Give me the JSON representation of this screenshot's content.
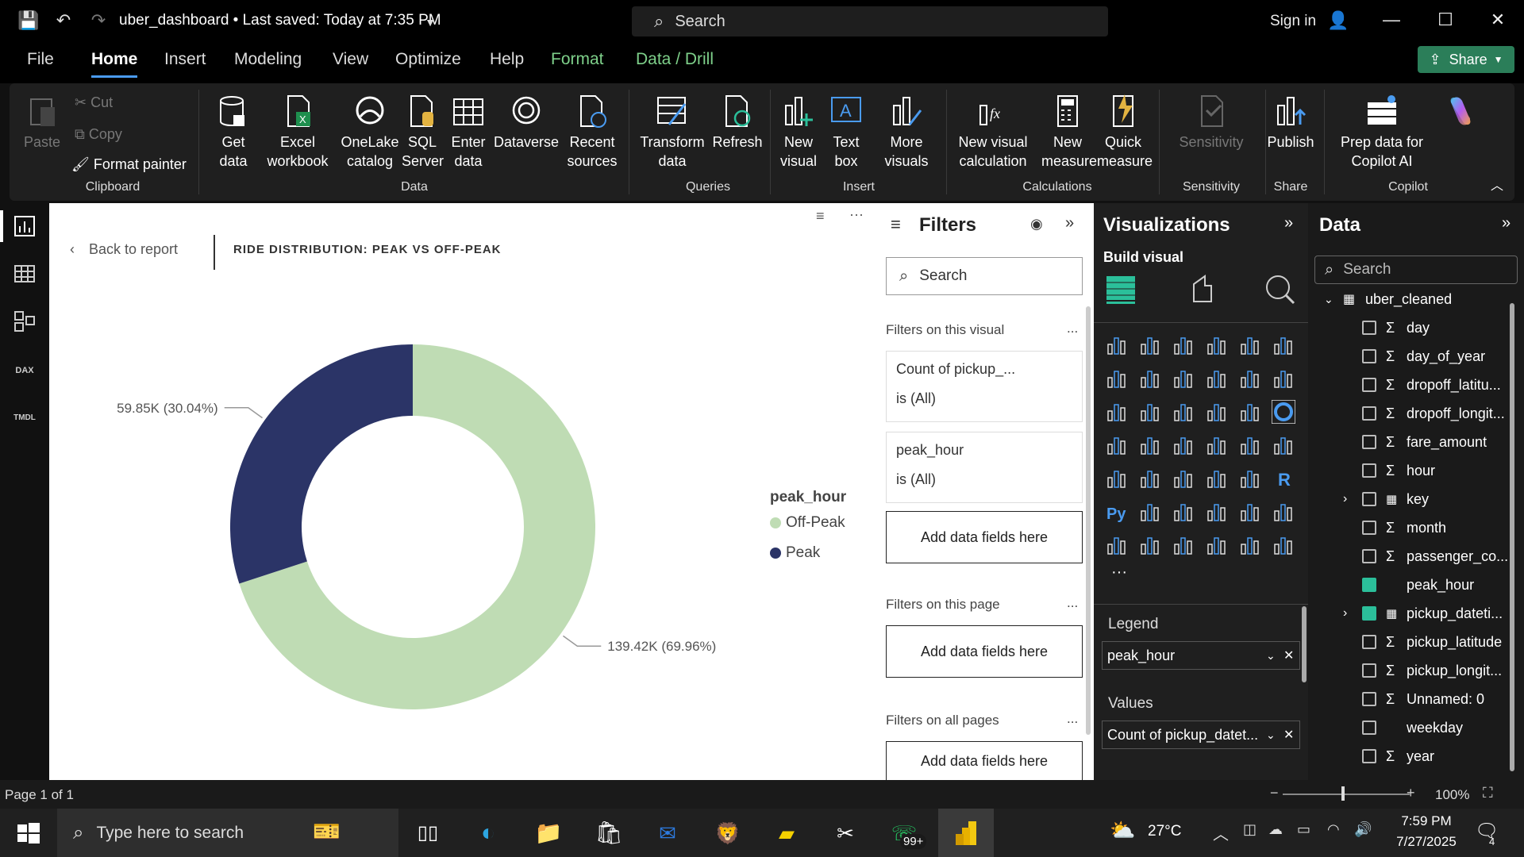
{
  "titlebar": {
    "doc_title": "uber_dashboard • Last saved: Today at 7:35 PM",
    "search_placeholder": "Search",
    "signin": "Sign in"
  },
  "menu": {
    "items": [
      "File",
      "Home",
      "Insert",
      "Modeling",
      "View",
      "Optimize",
      "Help",
      "Format",
      "Data / Drill"
    ],
    "share": "Share"
  },
  "ribbon": {
    "clipboard": {
      "paste": "Paste",
      "cut": "Cut",
      "copy": "Copy",
      "format_painter": "Format painter",
      "group": "Clipboard"
    },
    "data": {
      "get_data": "Get data",
      "excel": "Excel workbook",
      "onelake": "OneLake catalog",
      "sql": "SQL Server",
      "enter": "Enter data",
      "dataverse": "Dataverse",
      "recent": "Recent sources",
      "group": "Data"
    },
    "queries": {
      "transform": "Transform data",
      "refresh": "Refresh",
      "group": "Queries"
    },
    "insert": {
      "new_visual": "New visual",
      "text_box": "Text box",
      "more_visuals": "More visuals",
      "group": "Insert"
    },
    "calculations": {
      "new_vis_calc": "New visual calculation",
      "new_measure": "New measure",
      "quick_measure": "Quick measure",
      "group": "Calculations"
    },
    "sensitivity": {
      "label": "Sensitivity",
      "group": "Sensitivity"
    },
    "share": {
      "publish": "Publish",
      "group": "Share"
    },
    "copilot": {
      "prep": "Prep data for Copilot AI",
      "group": "Copilot"
    }
  },
  "canvas": {
    "back": "Back to report",
    "visual_title": "RIDE DISTRIBUTION: PEAK VS OFF-PEAK"
  },
  "chart_data": {
    "type": "pie",
    "title": "RIDE DISTRIBUTION: PEAK VS OFF-PEAK",
    "legend_title": "peak_hour",
    "legend_position": "right",
    "slices": [
      {
        "name": "Off-Peak",
        "value": 139420,
        "label": "139.42K (69.96%)",
        "color": "#bfdcb4"
      },
      {
        "name": "Peak",
        "value": 59850,
        "label": "59.85K (30.04%)",
        "color": "#2b3467"
      }
    ]
  },
  "filters": {
    "title": "Filters",
    "search": "Search",
    "on_visual": "Filters on this visual",
    "card1_name": "Count of pickup_...",
    "card1_state": "is (All)",
    "card2_name": "peak_hour",
    "card2_state": "is (All)",
    "add": "Add data fields here",
    "on_page": "Filters on this page",
    "on_all": "Filters on all pages",
    "more": "..."
  },
  "visualizations": {
    "title": "Visualizations",
    "build": "Build visual",
    "legend_label": "Legend",
    "legend_value": "peak_hour",
    "values_label": "Values",
    "values_value": "Count of pickup_datet..."
  },
  "data_pane": {
    "title": "Data",
    "search": "Search",
    "table": "uber_cleaned",
    "fields": [
      {
        "name": "day",
        "sigma": true,
        "checked": false,
        "expand": false
      },
      {
        "name": "day_of_year",
        "sigma": true,
        "checked": false,
        "expand": false
      },
      {
        "name": "dropoff_latitu...",
        "sigma": true,
        "checked": false,
        "expand": false
      },
      {
        "name": "dropoff_longit...",
        "sigma": true,
        "checked": false,
        "expand": false
      },
      {
        "name": "fare_amount",
        "sigma": true,
        "checked": false,
        "expand": false
      },
      {
        "name": "hour",
        "sigma": true,
        "checked": false,
        "expand": false
      },
      {
        "name": "key",
        "sigma": false,
        "checked": false,
        "expand": true
      },
      {
        "name": "month",
        "sigma": true,
        "checked": false,
        "expand": false
      },
      {
        "name": "passenger_co...",
        "sigma": true,
        "checked": false,
        "expand": false
      },
      {
        "name": "peak_hour",
        "sigma": false,
        "checked": true,
        "expand": false
      },
      {
        "name": "pickup_dateti...",
        "sigma": false,
        "checked": true,
        "expand": true
      },
      {
        "name": "pickup_latitude",
        "sigma": true,
        "checked": false,
        "expand": false
      },
      {
        "name": "pickup_longit...",
        "sigma": true,
        "checked": false,
        "expand": false
      },
      {
        "name": "Unnamed: 0",
        "sigma": true,
        "checked": false,
        "expand": false
      },
      {
        "name": "weekday",
        "sigma": false,
        "checked": false,
        "expand": false
      },
      {
        "name": "year",
        "sigma": true,
        "checked": false,
        "expand": false
      }
    ]
  },
  "status": {
    "page": "Page 1 of 1",
    "zoom": "100%"
  },
  "taskbar": {
    "search": "Type here to search",
    "temp": "27°C",
    "time": "7:59 PM",
    "date": "7/27/2025",
    "badge": "99+",
    "notif": "4"
  }
}
